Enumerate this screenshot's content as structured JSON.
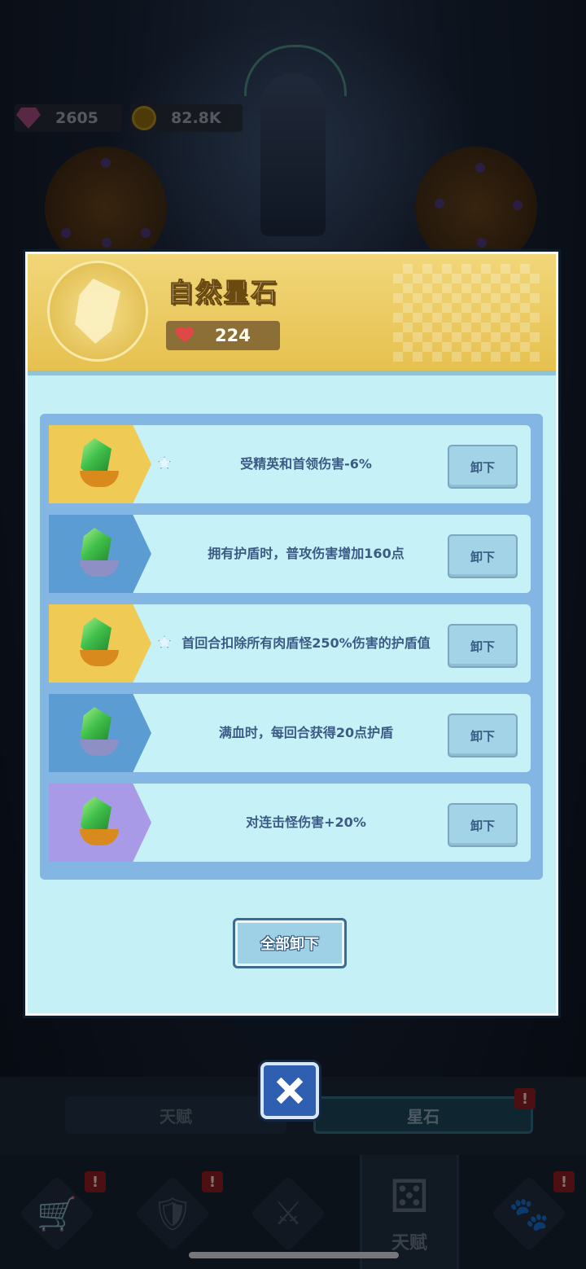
{
  "resources": {
    "gems": "2605",
    "coins": "82.8K"
  },
  "modal": {
    "title": "自然星石",
    "hp_value": "224",
    "stones": [
      {
        "frame": "gold",
        "starred": true,
        "effect": "受精英和首领伤害-6%",
        "button": "卸下"
      },
      {
        "frame": "blue",
        "starred": false,
        "effect": "拥有护盾时，普攻伤害增加160点",
        "button": "卸下"
      },
      {
        "frame": "gold",
        "starred": true,
        "effect": "首回合扣除所有肉盾怪250%伤害的护盾值",
        "button": "卸下"
      },
      {
        "frame": "blue",
        "starred": false,
        "effect": "满血时，每回合获得20点护盾",
        "button": "卸下"
      },
      {
        "frame": "purple",
        "starred": false,
        "effect": "对连击怪伤害+20%",
        "button": "卸下"
      }
    ],
    "unequip_all_label": "全部卸下"
  },
  "tabs": {
    "talent": "天赋",
    "stone": "星石",
    "alert": "!"
  },
  "nav": {
    "active_label": "天赋",
    "items": [
      "shop",
      "armor",
      "battle",
      "talent",
      "pet"
    ]
  },
  "colors": {
    "header_gold": "#e6c14f",
    "panel_cyan": "#c4f0f6",
    "list_blue": "#84b6e3",
    "text_blue": "#3b5a84",
    "close_blue": "#2f5fb0"
  }
}
